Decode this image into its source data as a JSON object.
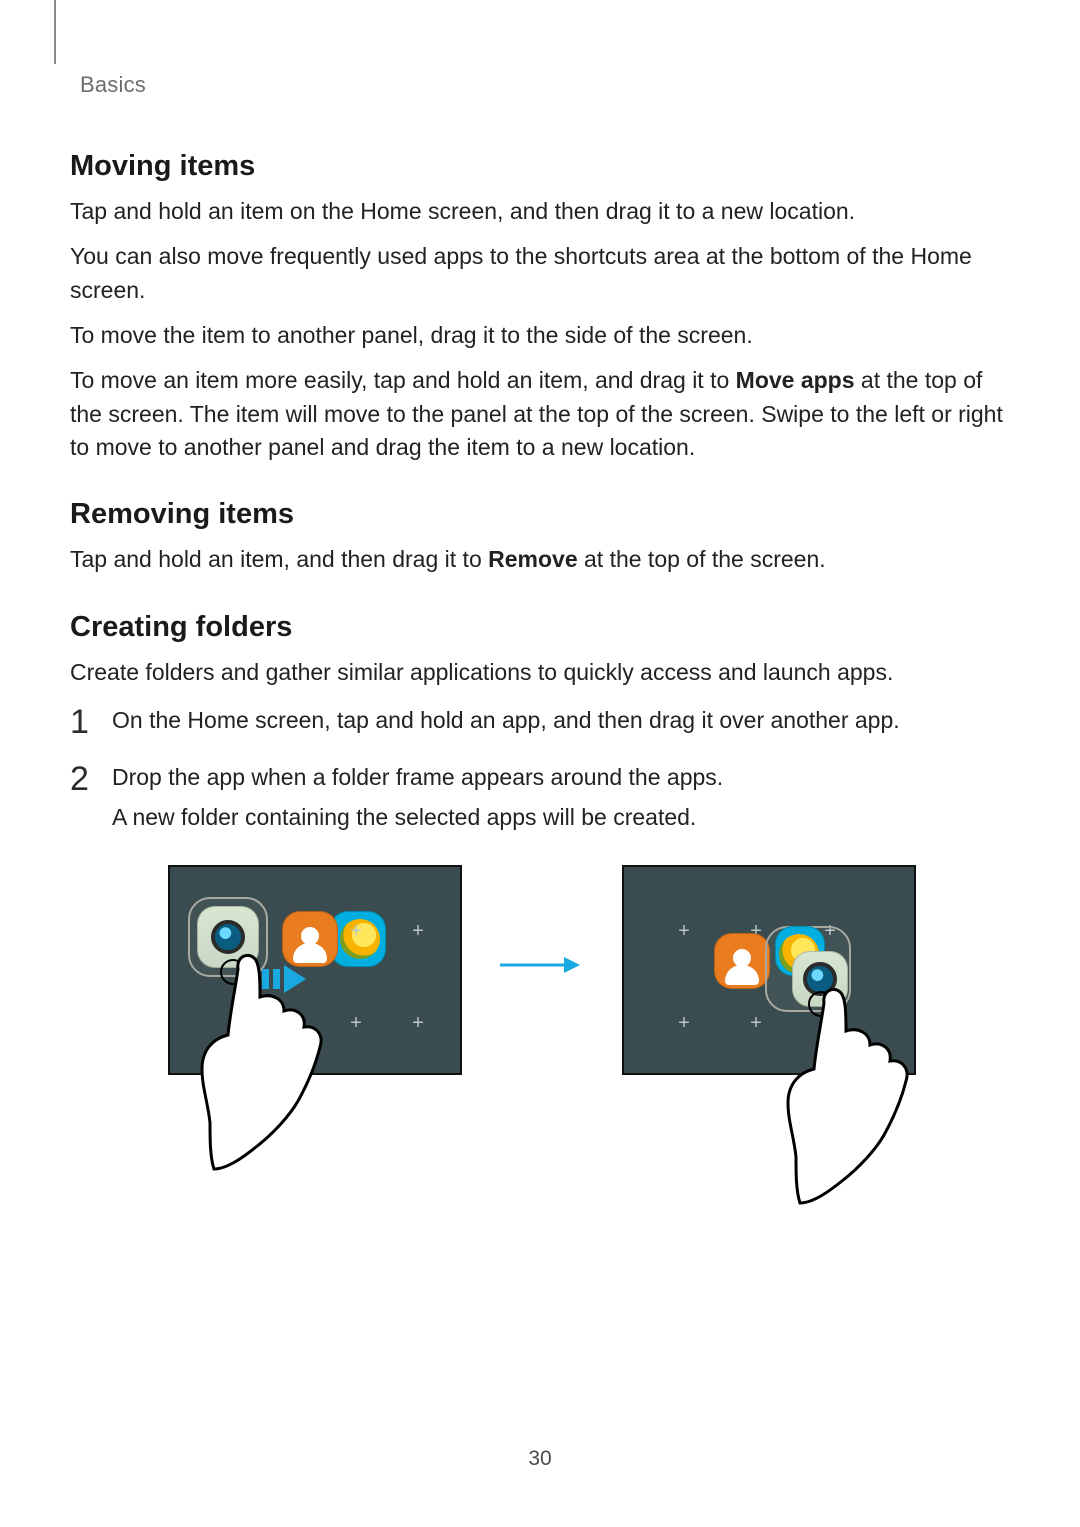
{
  "header": {
    "section": "Basics"
  },
  "sections": {
    "moving": {
      "title": "Moving items",
      "p1": "Tap and hold an item on the Home screen, and then drag it to a new location.",
      "p2": "You can also move frequently used apps to the shortcuts area at the bottom of the Home screen.",
      "p3": "To move the item to another panel, drag it to the side of the screen.",
      "p4_a": "To move an item more easily, tap and hold an item, and drag it to ",
      "p4_bold": "Move apps",
      "p4_b": " at the top of the screen. The item will move to the panel at the top of the screen. Swipe to the left or right to move to another panel and drag the item to a new location."
    },
    "removing": {
      "title": "Removing items",
      "p1_a": "Tap and hold an item, and then drag it to ",
      "p1_bold": "Remove",
      "p1_b": " at the top of the screen."
    },
    "creating": {
      "title": "Creating folders",
      "intro": "Create folders and gather similar applications to quickly access and launch apps.",
      "step1": "On the Home screen, tap and hold an app, and then drag it over another app.",
      "step2": "Drop the app when a folder frame appears around the apps.",
      "step2b": "A new folder containing the selected apps will be created."
    }
  },
  "page_number": "30"
}
